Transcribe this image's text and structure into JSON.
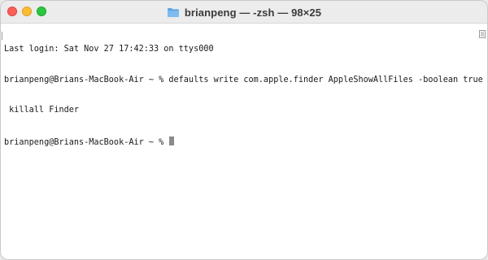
{
  "window": {
    "title": "brianpeng — -zsh — 98×25"
  },
  "icons": {
    "title_icon": "folder-icon",
    "scroll_icon": "marks-list-icon"
  },
  "colors": {
    "close": "#ff5f57",
    "minimize": "#febc2e",
    "zoom": "#28c840",
    "folder": "#5aa6e6",
    "cursor": "#8a8a8a"
  },
  "terminal": {
    "lines": [
      "Last login: Sat Nov 27 17:42:33 on ttys000",
      "brianpeng@Brians-MacBook-Air ~ % defaults write com.apple.finder AppleShowAllFiles -boolean true ;",
      " killall Finder",
      "brianpeng@Brians-MacBook-Air ~ % "
    ]
  }
}
